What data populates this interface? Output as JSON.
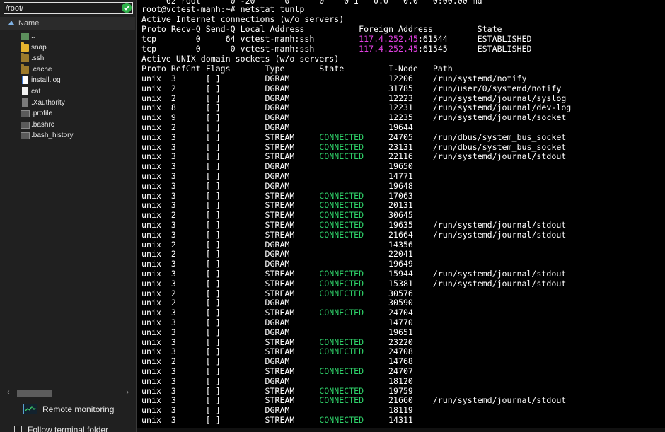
{
  "sidebar": {
    "path_value": "/root/",
    "column_header": "Name",
    "files": [
      {
        "name": "..",
        "icon": "folder-up-icon"
      },
      {
        "name": "snap",
        "icon": "folder-icon"
      },
      {
        "name": ".ssh",
        "icon": "folder-icon"
      },
      {
        "name": ".cache",
        "icon": "folder-icon"
      },
      {
        "name": "install.log",
        "icon": "file-icon"
      },
      {
        "name": "cat",
        "icon": "file-icon"
      },
      {
        "name": ".Xauthority",
        "icon": "file-icon"
      },
      {
        "name": ".profile",
        "icon": "file-icon"
      },
      {
        "name": ".bashrc",
        "icon": "file-icon"
      },
      {
        "name": ".bash_history",
        "icon": "file-icon"
      }
    ],
    "remote_monitoring_label": "Remote monitoring",
    "follow_label": "Follow terminal folder"
  },
  "terminal": {
    "top_partial": "     62 root      0 -20      0      0    0 I   0.0   0.0   0:00.00 md",
    "prompt": "root@vctest-manh:~# netstat tunlp",
    "inet_header": "Active Internet connections (w/o servers)",
    "inet_columns": "Proto Recv-Q Send-Q Local Address           Foreign Address         State",
    "inet_rows": [
      {
        "pre": "tcp        0     64 vctest-manh:ssh         ",
        "ip": "117.4.252.45",
        "post": ":61544      ESTABLISHED"
      },
      {
        "pre": "tcp        0      0 vctest-manh:ssh         ",
        "ip": "117.4.252.45",
        "post": ":61545      ESTABLISHED"
      }
    ],
    "unix_header": "Active UNIX domain sockets (w/o servers)",
    "unix_columns": "Proto RefCnt Flags       Type       State         I-Node   Path",
    "unix_rows": [
      {
        "pre": "unix  3      [ ]         DGRAM                    ",
        "state": "",
        "post": "12206    /run/systemd/notify"
      },
      {
        "pre": "unix  2      [ ]         DGRAM                    ",
        "state": "",
        "post": "31785    /run/user/0/systemd/notify"
      },
      {
        "pre": "unix  2      [ ]         DGRAM                    ",
        "state": "",
        "post": "12223    /run/systemd/journal/syslog"
      },
      {
        "pre": "unix  8      [ ]         DGRAM                    ",
        "state": "",
        "post": "12231    /run/systemd/journal/dev-log"
      },
      {
        "pre": "unix  9      [ ]         DGRAM                    ",
        "state": "",
        "post": "12235    /run/systemd/journal/socket"
      },
      {
        "pre": "unix  2      [ ]         DGRAM                    ",
        "state": "",
        "post": "19644"
      },
      {
        "pre": "unix  3      [ ]         STREAM     ",
        "state": "CONNECTED",
        "post": "     24705    /run/dbus/system_bus_socket"
      },
      {
        "pre": "unix  3      [ ]         STREAM     ",
        "state": "CONNECTED",
        "post": "     23131    /run/dbus/system_bus_socket"
      },
      {
        "pre": "unix  3      [ ]         STREAM     ",
        "state": "CONNECTED",
        "post": "     22116    /run/systemd/journal/stdout"
      },
      {
        "pre": "unix  3      [ ]         DGRAM                    ",
        "state": "",
        "post": "19650"
      },
      {
        "pre": "unix  3      [ ]         DGRAM                    ",
        "state": "",
        "post": "14771"
      },
      {
        "pre": "unix  3      [ ]         DGRAM                    ",
        "state": "",
        "post": "19648"
      },
      {
        "pre": "unix  3      [ ]         STREAM     ",
        "state": "CONNECTED",
        "post": "     17063"
      },
      {
        "pre": "unix  3      [ ]         STREAM     ",
        "state": "CONNECTED",
        "post": "     20131"
      },
      {
        "pre": "unix  2      [ ]         STREAM     ",
        "state": "CONNECTED",
        "post": "     30645"
      },
      {
        "pre": "unix  3      [ ]         STREAM     ",
        "state": "CONNECTED",
        "post": "     19635    /run/systemd/journal/stdout"
      },
      {
        "pre": "unix  3      [ ]         STREAM     ",
        "state": "CONNECTED",
        "post": "     21664    /run/systemd/journal/stdout"
      },
      {
        "pre": "unix  2      [ ]         DGRAM                    ",
        "state": "",
        "post": "14356"
      },
      {
        "pre": "unix  2      [ ]         DGRAM                    ",
        "state": "",
        "post": "22041"
      },
      {
        "pre": "unix  3      [ ]         DGRAM                    ",
        "state": "",
        "post": "19649"
      },
      {
        "pre": "unix  3      [ ]         STREAM     ",
        "state": "CONNECTED",
        "post": "     15944    /run/systemd/journal/stdout"
      },
      {
        "pre": "unix  3      [ ]         STREAM     ",
        "state": "CONNECTED",
        "post": "     15381    /run/systemd/journal/stdout"
      },
      {
        "pre": "unix  2      [ ]         STREAM     ",
        "state": "CONNECTED",
        "post": "     30576"
      },
      {
        "pre": "unix  2      [ ]         DGRAM                    ",
        "state": "",
        "post": "30590"
      },
      {
        "pre": "unix  3      [ ]         STREAM     ",
        "state": "CONNECTED",
        "post": "     24704"
      },
      {
        "pre": "unix  3      [ ]         DGRAM                    ",
        "state": "",
        "post": "14770"
      },
      {
        "pre": "unix  3      [ ]         DGRAM                    ",
        "state": "",
        "post": "19651"
      },
      {
        "pre": "unix  3      [ ]         STREAM     ",
        "state": "CONNECTED",
        "post": "     23220"
      },
      {
        "pre": "unix  3      [ ]         STREAM     ",
        "state": "CONNECTED",
        "post": "     24708"
      },
      {
        "pre": "unix  2      [ ]         DGRAM                    ",
        "state": "",
        "post": "14768"
      },
      {
        "pre": "unix  3      [ ]         STREAM     ",
        "state": "CONNECTED",
        "post": "     24707"
      },
      {
        "pre": "unix  3      [ ]         DGRAM                    ",
        "state": "",
        "post": "18120"
      },
      {
        "pre": "unix  3      [ ]         STREAM     ",
        "state": "CONNECTED",
        "post": "     19759"
      },
      {
        "pre": "unix  3      [ ]         STREAM     ",
        "state": "CONNECTED",
        "post": "     21660    /run/systemd/journal/stdout"
      },
      {
        "pre": "unix  3      [ ]         DGRAM                    ",
        "state": "",
        "post": "18119"
      },
      {
        "pre": "unix  3      [ ]         STREAM     ",
        "state": "CONNECTED",
        "post": "     14311"
      }
    ]
  },
  "colors": {
    "connected": "#2fd36a",
    "ip": "#e040e0",
    "text": "#ffffff",
    "sidebar_bg": "#202020"
  }
}
